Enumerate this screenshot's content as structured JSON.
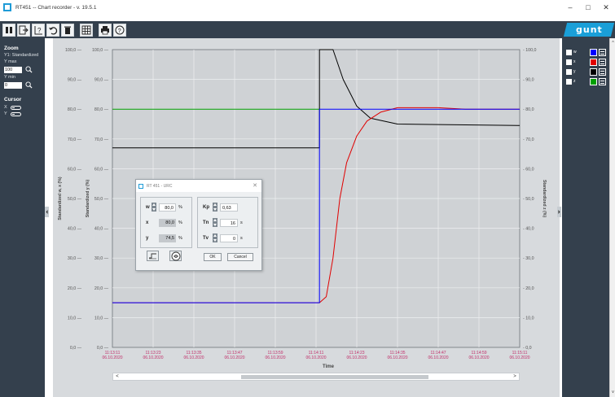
{
  "window": {
    "title": "RT451 -- Chart recorder - v. 19.5.1",
    "controls": [
      "–",
      "□",
      "✕"
    ]
  },
  "toolbar": {
    "buttons": [
      "pause",
      "export",
      "axis-help",
      "undo",
      "delete",
      "grid",
      "print",
      "help"
    ],
    "logo_text": "gunt"
  },
  "left_panel": {
    "zoom_title": "Zoom",
    "zoom_mode": "Y1: Standardized",
    "ymax_label": "Y max",
    "ymax_value": "100",
    "ymin_label": "Y min",
    "ymin_value": "0",
    "cursor_title": "Cursor",
    "cursor_x_label": "X",
    "cursor_y_label": "Y"
  },
  "legend_panel": {
    "items": [
      {
        "name": "w",
        "color": "#0000ff"
      },
      {
        "name": "x",
        "color": "#e00000"
      },
      {
        "name": "y",
        "color": "#000000"
      },
      {
        "name": "z",
        "color": "#00a000"
      }
    ]
  },
  "chart_data": {
    "type": "line",
    "y_ticks": [
      "0,0",
      "10,0",
      "20,0",
      "30,0",
      "40,0",
      "50,0",
      "60,0",
      "70,0",
      "80,0",
      "90,0",
      "100,0"
    ],
    "outer_y_ticks": [
      "0,0",
      "10,0",
      "20,0",
      "30,0",
      "40,0",
      "50,0",
      "60,0",
      "70,0",
      "80,0",
      "90,0",
      "100,0"
    ],
    "right_y_ticks": [
      "0,0",
      "10,0",
      "20,0",
      "30,0",
      "40,0",
      "50,0",
      "60,0",
      "70,0",
      "80,0",
      "90,0",
      "100,0"
    ],
    "ylim": [
      0,
      100
    ],
    "x_ticks": [
      {
        "time": "11:13:11",
        "date": "06.10.2020"
      },
      {
        "time": "11:13:23",
        "date": "06.10.2020"
      },
      {
        "time": "11:13:35",
        "date": "06.10.2020"
      },
      {
        "time": "11:13:47",
        "date": "06.10.2020"
      },
      {
        "time": "11:13:59",
        "date": "06.10.2020"
      },
      {
        "time": "11:14:11",
        "date": "06.10.2020"
      },
      {
        "time": "11:14:23",
        "date": "06.10.2020"
      },
      {
        "time": "11:14:35",
        "date": "06.10.2020"
      },
      {
        "time": "11:14:47",
        "date": "06.10.2020"
      },
      {
        "time": "11:14:59",
        "date": "06.10.2020"
      },
      {
        "time": "11:15:11",
        "date": "06.10.2020"
      }
    ],
    "xlim": [
      "11:13:11",
      "11:15:11"
    ],
    "xlabel": "Time",
    "ylabel_left_outer": "Standardized  w, x  (%)",
    "ylabel_left_inner": "Standardized  y  (%)",
    "ylabel_right": "Standardized  z  (%)",
    "grid": true,
    "series": [
      {
        "name": "w",
        "color": "#0000ff",
        "points": [
          [
            "11:13:11",
            15.0
          ],
          [
            "11:14:12",
            15.0
          ],
          [
            "11:14:12",
            80.0
          ],
          [
            "11:15:11",
            80.0
          ]
        ]
      },
      {
        "name": "x",
        "color": "#e00000",
        "points": [
          [
            "11:13:11",
            15.0
          ],
          [
            "11:14:12",
            15.0
          ],
          [
            "11:14:14",
            17.0
          ],
          [
            "11:14:16",
            30.0
          ],
          [
            "11:14:18",
            50.0
          ],
          [
            "11:14:20",
            62.0
          ],
          [
            "11:14:23",
            71.0
          ],
          [
            "11:14:26",
            76.0
          ],
          [
            "11:14:30",
            79.0
          ],
          [
            "11:14:35",
            80.5
          ],
          [
            "11:14:47",
            80.5
          ],
          [
            "11:14:55",
            80.0
          ],
          [
            "11:15:11",
            80.0
          ]
        ]
      },
      {
        "name": "y",
        "color": "#000000",
        "points": [
          [
            "11:13:11",
            67.0
          ],
          [
            "11:14:12",
            67.0
          ],
          [
            "11:14:12",
            100.0
          ],
          [
            "11:14:16",
            100.0
          ],
          [
            "11:14:19",
            90.0
          ],
          [
            "11:14:23",
            81.0
          ],
          [
            "11:14:27",
            77.0
          ],
          [
            "11:14:35",
            75.0
          ],
          [
            "11:15:11",
            74.5
          ]
        ]
      },
      {
        "name": "z",
        "color": "#00a000",
        "points": [
          [
            "11:13:11",
            80.0
          ],
          [
            "11:14:12",
            80.0
          ]
        ]
      }
    ]
  },
  "dialog": {
    "title": "RT 451 - URC",
    "close": "✕",
    "w_label": "w",
    "w_value": "80,0",
    "w_unit": "%",
    "x_label": "x",
    "x_value": "80,0",
    "x_unit": "%",
    "y_label": "y",
    "y_value": "74,5",
    "y_unit": "%",
    "kp_label": "Kp",
    "kp_value": "0,63",
    "tn_label": "Tn",
    "tn_value": "16",
    "tn_unit": "s",
    "tv_label": "Tv",
    "tv_value": "0",
    "tv_unit": "s",
    "ok_label": "OK",
    "cancel_label": "Cancel"
  },
  "scrollbar": {
    "left_arrow": "<",
    "right_arrow": ">",
    "up_arrow": "^",
    "down_arrow": "v"
  }
}
